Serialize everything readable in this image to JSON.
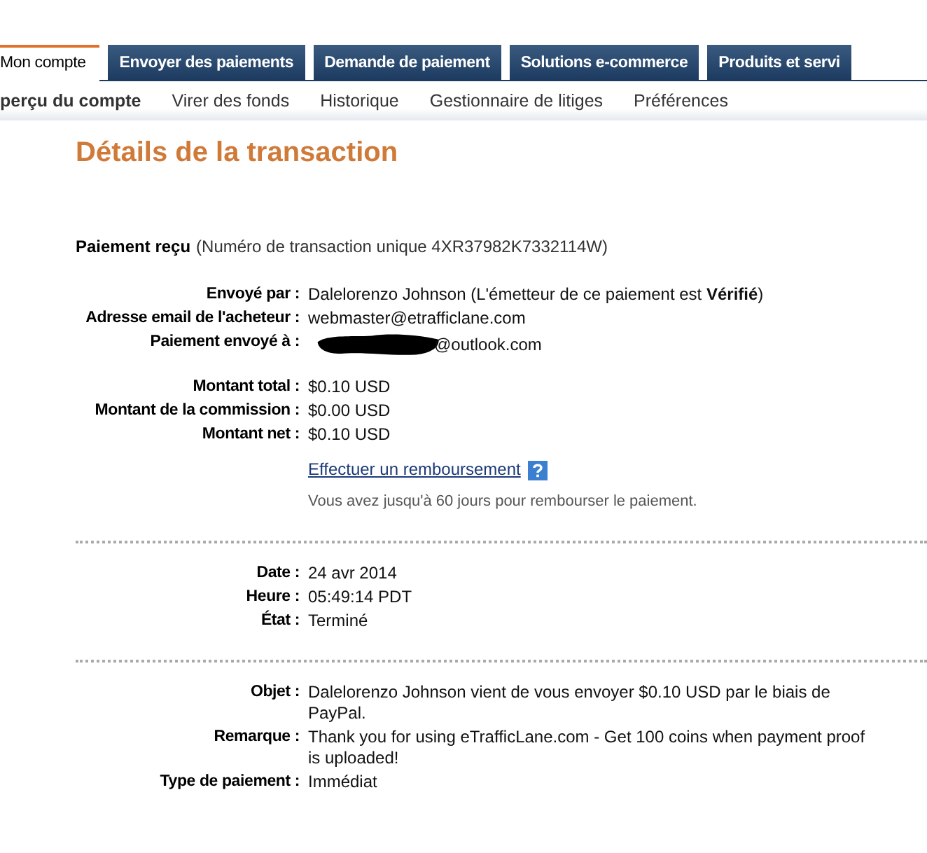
{
  "tabs": [
    {
      "label": "Mon compte",
      "selected": true
    },
    {
      "label": "Envoyer des paiements",
      "selected": false
    },
    {
      "label": "Demande de paiement",
      "selected": false
    },
    {
      "label": "Solutions e-commerce",
      "selected": false
    },
    {
      "label": "Produits et servi",
      "selected": false
    }
  ],
  "subnav": [
    {
      "label": "perçu du compte",
      "selected": true
    },
    {
      "label": "Virer des fonds",
      "selected": false
    },
    {
      "label": "Historique",
      "selected": false
    },
    {
      "label": "Gestionnaire de litiges",
      "selected": false
    },
    {
      "label": "Préférences",
      "selected": false
    }
  ],
  "title": "Détails de la transaction",
  "payment_header": {
    "label": "Paiement reçu",
    "detail": "(Numéro de transaction unique 4XR37982K7332114W)"
  },
  "sections": [
    [
      [
        {
          "kind": "text",
          "label": "Envoyé par :",
          "value": "Dalelorenzo Johnson (L'émetteur de ce paiement est **Vérifié**)"
        },
        {
          "kind": "text",
          "label": "Adresse email de l'acheteur :",
          "value": "webmaster@etrafficlane.com"
        },
        {
          "kind": "redacted",
          "label": "Paiement envoyé à :",
          "value": "@outlook.com"
        }
      ],
      [
        {
          "kind": "text",
          "label": "Montant total :",
          "value": "$0.10 USD"
        },
        {
          "kind": "text",
          "label": "Montant de la commission :",
          "value": "$0.00 USD"
        },
        {
          "kind": "text",
          "label": "Montant net :",
          "value": "$0.10 USD"
        }
      ],
      [
        {
          "kind": "link",
          "value": "Effectuer un remboursement",
          "note": "Vous avez jusqu'à 60 jours pour rembourser le paiement."
        }
      ]
    ],
    [
      [
        {
          "kind": "text",
          "label": "Date :",
          "value": "24 avr 2014"
        },
        {
          "kind": "text",
          "label": "Heure :",
          "value": "05:49:14 PDT"
        },
        {
          "kind": "text",
          "label": "État :",
          "value": "Terminé"
        }
      ]
    ],
    [
      [
        {
          "kind": "text",
          "label": "Objet :",
          "value": "Dalelorenzo Johnson vient de vous envoyer $0.10 USD par le biais de PayPal."
        },
        {
          "kind": "text",
          "label": "Remarque :",
          "value": "Thank you for using eTrafficLane.com - Get 100 coins when payment proof is uploaded!"
        },
        {
          "kind": "text",
          "label": "Type de paiement :",
          "value": "Immédiat"
        }
      ]
    ]
  ]
}
